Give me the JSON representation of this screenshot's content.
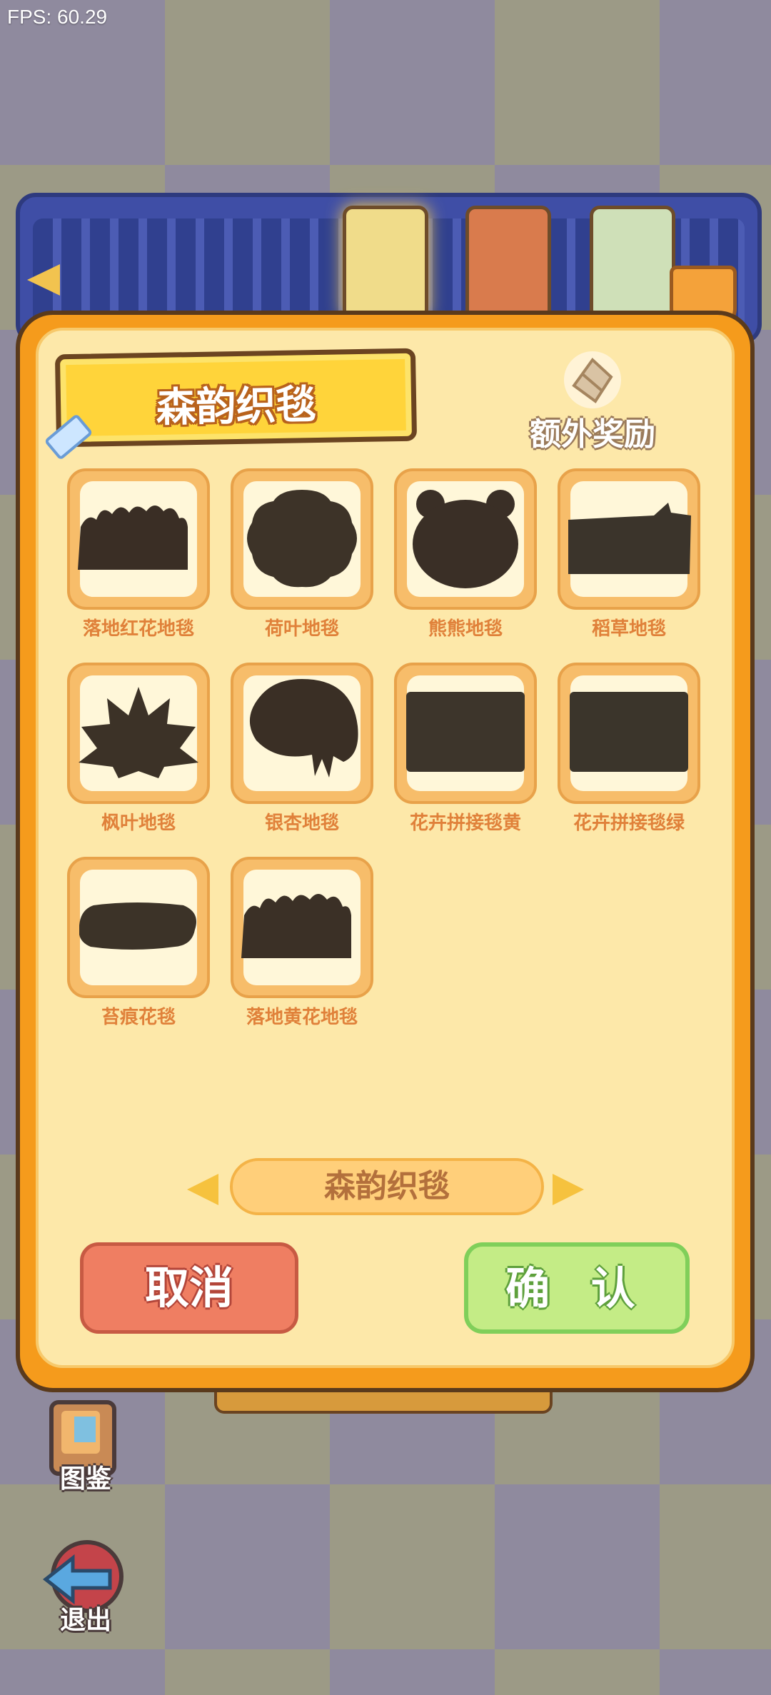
{
  "fps": "FPS: 60.29",
  "dialog": {
    "title": "森韵织毯",
    "bonus_label": "额外奖励",
    "items": [
      {
        "label": "落地红花地毯",
        "shape": "bush",
        "color": "#3a2e25"
      },
      {
        "label": "荷叶地毯",
        "shape": "lotus",
        "color": "#3d3328"
      },
      {
        "label": "熊熊地毯",
        "shape": "bear",
        "color": "#3a2f26"
      },
      {
        "label": "稻草地毯",
        "shape": "straw",
        "color": "#3b342b"
      },
      {
        "label": "枫叶地毯",
        "shape": "maple",
        "color": "#3c3227"
      },
      {
        "label": "银杏地毯",
        "shape": "ginkgo",
        "color": "#3a2f25"
      },
      {
        "label": "花卉拼接毯黄",
        "shape": "rect",
        "color": "#3d352b"
      },
      {
        "label": "花卉拼接毯绿",
        "shape": "rect",
        "color": "#3b352b"
      },
      {
        "label": "苔痕花毯",
        "shape": "oval",
        "color": "#3c3328"
      },
      {
        "label": "落地黄花地毯",
        "shape": "bush",
        "color": "#3b3026"
      }
    ],
    "selector_label": "森韵织毯",
    "cancel_label": "取消",
    "confirm_label": "确 认"
  },
  "side": {
    "catalog_label": "图鉴",
    "exit_label": "退出"
  }
}
